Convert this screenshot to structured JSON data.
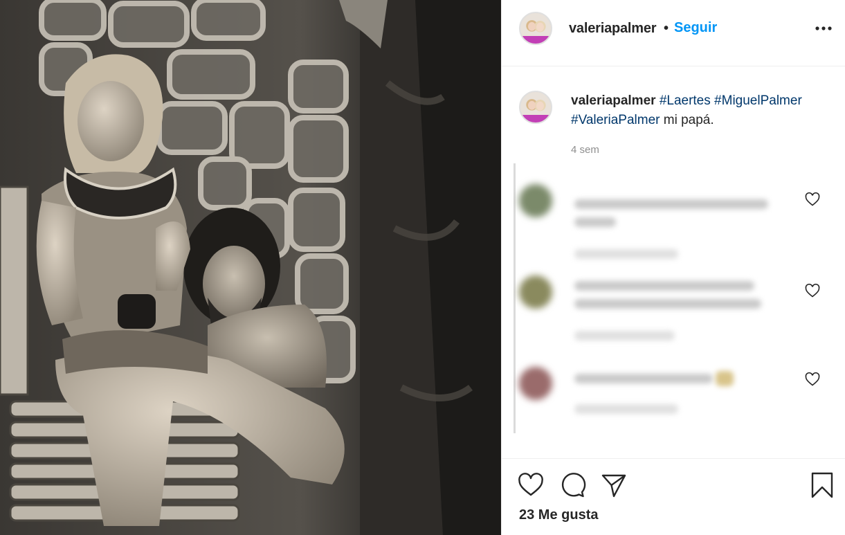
{
  "post": {
    "photo_description_icon": "black-and-white-theatre-photo"
  },
  "header": {
    "username": "valeriapalmer",
    "separator": "•",
    "follow_label": "Seguir",
    "more_icon": "ellipsis-icon"
  },
  "caption": {
    "username": "valeriapalmer",
    "hashtags": [
      "#Laertes",
      "#MiguelPalmer",
      "#ValeriaPalmer"
    ],
    "text": "mi papá.",
    "time": "4 sem"
  },
  "comments": [
    {
      "heart_icon": "heart-outline-icon"
    },
    {
      "heart_icon": "heart-outline-icon"
    },
    {
      "heart_icon": "heart-outline-icon"
    }
  ],
  "actions": {
    "like_icon": "heart-outline-icon",
    "comment_icon": "comment-bubble-icon",
    "share_icon": "paper-plane-icon",
    "save_icon": "bookmark-icon",
    "likes": "23 Me gusta"
  },
  "colors": {
    "link": "#00376b",
    "follow": "#0095f6",
    "muted": "#8e8e8e",
    "text": "#262626"
  }
}
